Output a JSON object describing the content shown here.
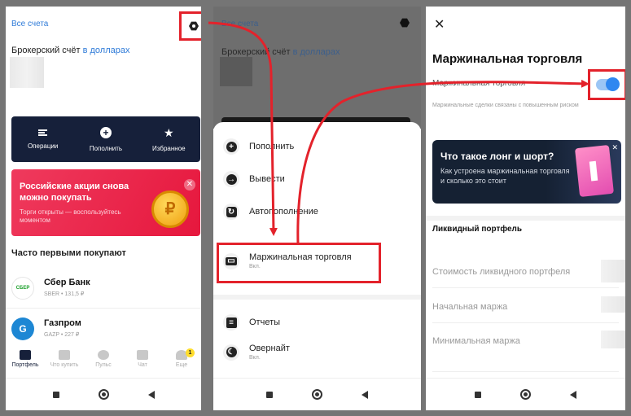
{
  "panel1": {
    "all_accounts": "Все счета",
    "account_label": "Брокерский счёт",
    "account_currency": "в долларах",
    "actions": [
      {
        "label": "Операции",
        "icon": "operations-icon"
      },
      {
        "label": "Пополнить",
        "icon": "plus-icon"
      },
      {
        "label": "Избранное",
        "icon": "star-icon"
      }
    ],
    "banner": {
      "title": "Российские акции снова можно покупать",
      "subtitle": "Торги открыты — воспользуйтесь моментом",
      "close": "✕",
      "coin": "₽"
    },
    "section_title": "Часто первыми покупают",
    "stocks": [
      {
        "name": "Сбер Банк",
        "meta": "SBER • 131,5 ₽",
        "logo_text": "СБЕР",
        "logo_bg": "#ffffff",
        "logo_fg": "#1a9f29"
      },
      {
        "name": "Газпром",
        "meta": "GAZP • 227 ₽",
        "logo_text": "G",
        "logo_bg": "#1d87d4",
        "logo_fg": "#ffffff"
      }
    ],
    "tabs": [
      {
        "label": "Портфель",
        "active": true
      },
      {
        "label": "Что купить",
        "active": false
      },
      {
        "label": "Пульс",
        "active": false
      },
      {
        "label": "Чат",
        "active": false
      },
      {
        "label": "Еще",
        "active": false,
        "badge": "1"
      }
    ]
  },
  "panel2": {
    "all_accounts": "Все счета",
    "account_label": "Брокерский счёт",
    "account_currency": "в долларах",
    "menu": [
      {
        "label": "Пополнить",
        "sub": "",
        "icon": "plus-icon",
        "glyph": "+"
      },
      {
        "label": "Вывести",
        "sub": "",
        "icon": "withdraw-icon",
        "glyph": "→"
      },
      {
        "label": "Автопополнение",
        "sub": "",
        "icon": "autofill-icon",
        "glyph": "↻"
      },
      {
        "label": "Маржинальная торговля",
        "sub": "Вкл.",
        "icon": "margin-trading-icon",
        "glyph": "▭"
      },
      {
        "label": "Отчеты",
        "sub": "",
        "icon": "reports-icon",
        "glyph": "≡"
      },
      {
        "label": "Овернайт",
        "sub": "Вкл.",
        "icon": "overnight-icon",
        "glyph": "☾"
      }
    ]
  },
  "panel3": {
    "close": "✕",
    "title": "Маржинальная торговля",
    "toggle_label": "Маржинальная торговля",
    "toggle_on": true,
    "note": "Маржинальные сделки связаны с повышенным риском",
    "promo": {
      "title": "Что такое лонг и шорт?",
      "subtitle": "Как устроена маржинальная торговля и сколько это стоит",
      "close": "✕"
    },
    "section_title": "Ликвидный портфель",
    "rows": [
      "Стоимость ликвидного портфеля",
      "Начальная маржа",
      "Минимальная маржа"
    ]
  },
  "colors": {
    "highlight": "#e3222b",
    "accent_blue": "#2f7bd8",
    "dark_navy": "#16203a"
  }
}
